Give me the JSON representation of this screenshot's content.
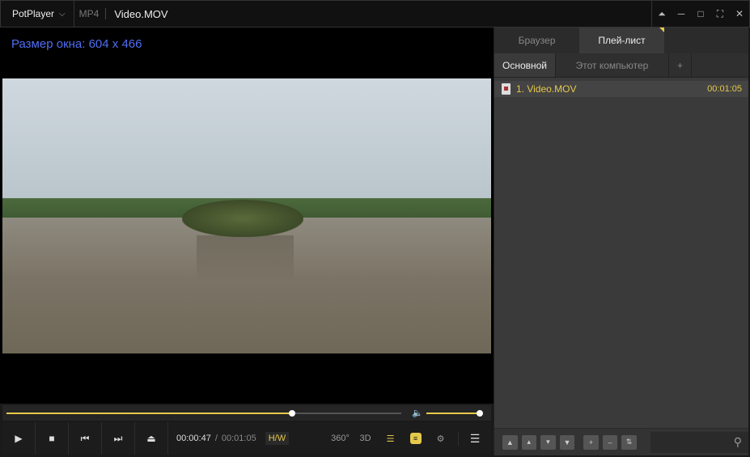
{
  "titlebar": {
    "app_name": "PotPlayer",
    "format": "MP4",
    "filename": "Video.MOV",
    "icons": [
      "chevron-down-icon",
      "pin-icon",
      "minimize-icon",
      "maximize-icon",
      "fullscreen-icon",
      "close-icon"
    ]
  },
  "video": {
    "osd_text": "Размер окна: 604 x 466"
  },
  "seek": {
    "progress_fraction": 0.723,
    "volume_fraction": 1.0
  },
  "controls": {
    "current_time": "00:00:47",
    "separator": "/",
    "total_time": "00:01:05",
    "hw_label": "H/W",
    "btn_360": "360°",
    "btn_3d": "3D"
  },
  "panel": {
    "tabs": [
      {
        "label": "Браузер",
        "active": false
      },
      {
        "label": "Плей-лист",
        "active": true
      }
    ],
    "subtabs": [
      {
        "label": "Основной",
        "active": true
      },
      {
        "label": "Этот компьютер",
        "active": false
      },
      {
        "label": "+",
        "active": false
      }
    ],
    "playlist": [
      {
        "title": "1. Video.MOV",
        "duration": "00:01:05"
      }
    ]
  },
  "colors": {
    "accent": "#e6c94a",
    "osd": "#4f6ef2",
    "background": "#1a1a1a",
    "panel": "#3a3a3a"
  }
}
